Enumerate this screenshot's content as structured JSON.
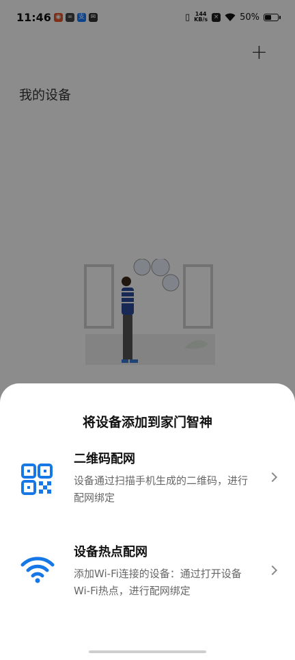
{
  "status_bar": {
    "time": "11:46",
    "net_speed_value": "144",
    "net_speed_unit": "KB/s",
    "battery": "50%"
  },
  "page": {
    "title": "我的设备",
    "add_icon": "plus-icon"
  },
  "sheet": {
    "title": "将设备添加到家门智神",
    "options": [
      {
        "title": "二维码配网",
        "description": "设备通过扫描手机生成的二维码，进行配网绑定",
        "icon": "qr-code-icon"
      },
      {
        "title": "设备热点配网",
        "description": "添加Wi-Fi连接的设备：通过打开设备Wi-Fi热点，进行配网绑定",
        "icon": "wifi-icon"
      }
    ]
  },
  "colors": {
    "accent": "#1677e6",
    "scrim": "#000000"
  }
}
